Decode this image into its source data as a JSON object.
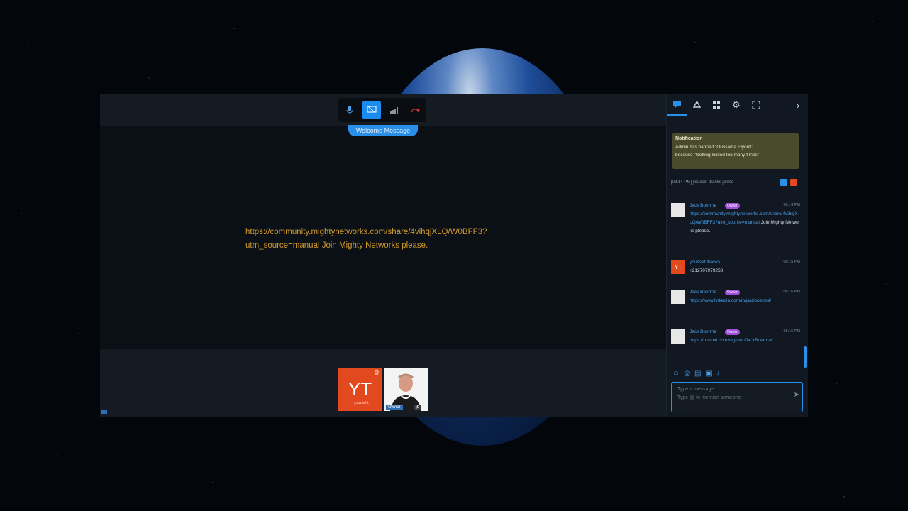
{
  "controls": {
    "mic_icon": "mic-icon",
    "screen_icon": "screen-share-icon",
    "signal_icon": "signal-icon",
    "hangup_icon": "hangup-icon",
    "welcome_label": "Welcome Message"
  },
  "stage": {
    "line1": "https://community.mightynetworks.com/share/4vihqjXLQ/W0BFF3?",
    "line2": "utm_source=manual Join Mighty Networks please."
  },
  "participants": [
    {
      "initials": "YT",
      "sub": "youssef t."
    },
    {
      "tag": "Owner",
      "tag2": "jb"
    }
  ],
  "sidebar": {
    "tabs": [
      "chat-icon",
      "recycle-icon",
      "grid-icon",
      "settings-icon",
      "fullscreen-icon"
    ],
    "collapse": "›"
  },
  "notification": {
    "title": "Notification",
    "body_line1": "Admin has banned \"Oussama Elyoufi\"",
    "body_line2": "because \"Getting kicked too many times\""
  },
  "system_line": "[08:14 PM] youssef tbanks joined",
  "messages": [
    {
      "name": "Jack Boerma",
      "badge": "Owner",
      "time": "08:14 PM",
      "link": "https://community.mightynetworks.com/share/4vihqjXLQ/W0BFF3?utm_source=manual",
      "text": " Join Mighty Networks please."
    },
    {
      "name": "youssef tbanks",
      "time": "08:15 PM",
      "text": "+212707979258",
      "initials": "YT"
    },
    {
      "name": "Jack Boerma",
      "badge": "Owner",
      "time": "08:16 PM",
      "link": "https://www.linkedin.com/in/jackboerma/"
    },
    {
      "name": "Jack Boerma",
      "badge": "Owner",
      "time": "08:16 PM",
      "link": "https://rumble.com/register/JackBoerma/"
    }
  ],
  "composer": {
    "placeholder1": "Type a message...",
    "placeholder2": "Type @ to mention someone"
  }
}
